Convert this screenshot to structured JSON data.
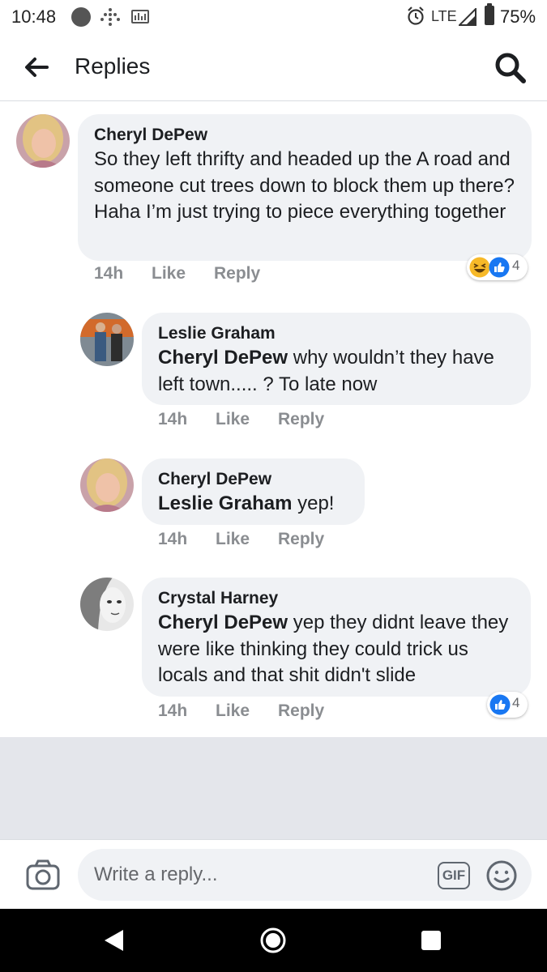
{
  "status_bar": {
    "time": "10:48",
    "network": "LTE",
    "battery": "75%"
  },
  "header": {
    "title": "Replies"
  },
  "comments": [
    {
      "author": "Cheryl DePew",
      "mention": "",
      "text": "So they left thrifty and headed up the A road and someone cut trees down to block them up there? Haha I’m just trying to piece everything together",
      "time": "14h",
      "like_label": "Like",
      "reply_label": "Reply",
      "reactions": [
        "haha-icon",
        "like-icon"
      ],
      "reaction_count": "4"
    },
    {
      "author": "Leslie Graham",
      "mention": "Cheryl DePew",
      "text": " why wouldn’t they have left town..... ? To late now",
      "time": "14h",
      "like_label": "Like",
      "reply_label": "Reply"
    },
    {
      "author": "Cheryl DePew",
      "mention": "Leslie Graham",
      "text": " yep!",
      "time": "14h",
      "like_label": "Like",
      "reply_label": "Reply"
    },
    {
      "author": "Crystal Harney",
      "mention": "Cheryl DePew",
      "text": " yep they didnt leave they were like thinking they could trick us locals and that shit didn't slide",
      "time": "14h",
      "like_label": "Like",
      "reply_label": "Reply",
      "reactions": [
        "like-icon"
      ],
      "reaction_count": "4"
    }
  ],
  "composer": {
    "placeholder": "Write a reply...",
    "gif_label": "GIF"
  },
  "colors": {
    "like_blue": "#1877f2",
    "haha_yellow": "#f7b928",
    "bubble_bg": "#f0f2f5",
    "muted_text": "#8a8d91"
  }
}
